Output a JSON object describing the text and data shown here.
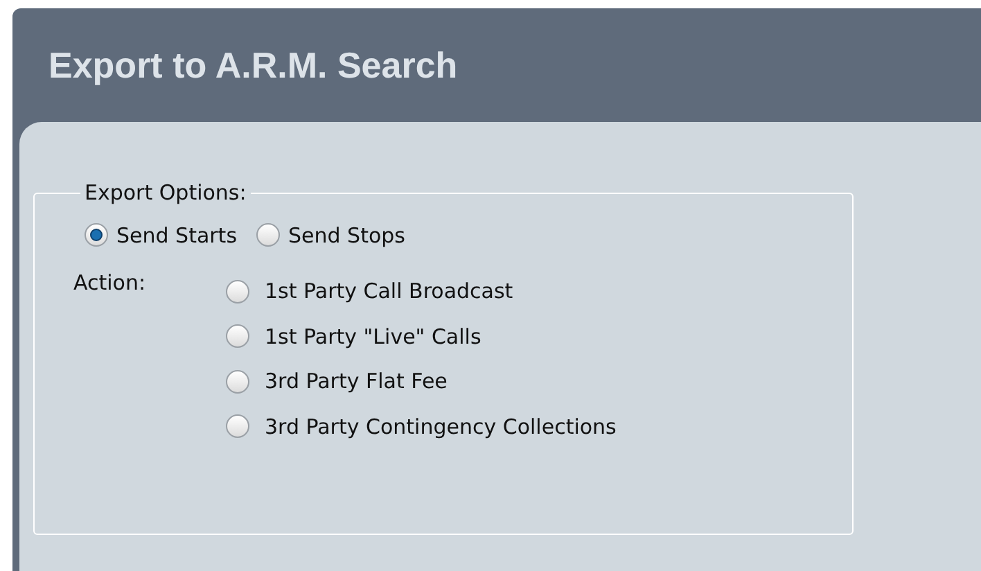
{
  "window": {
    "title": "Export to A.R.M. Search"
  },
  "export_options": {
    "legend": "Export Options:",
    "send": [
      {
        "label": "Send Starts",
        "selected": true
      },
      {
        "label": "Send Stops",
        "selected": false
      }
    ],
    "action_label": "Action:",
    "actions": [
      {
        "label": "1st Party Call Broadcast",
        "selected": false
      },
      {
        "label": "1st Party \"Live\" Calls",
        "selected": false
      },
      {
        "label": "3rd Party Flat Fee",
        "selected": false
      },
      {
        "label": "3rd Party Contingency Collections",
        "selected": false
      }
    ]
  }
}
